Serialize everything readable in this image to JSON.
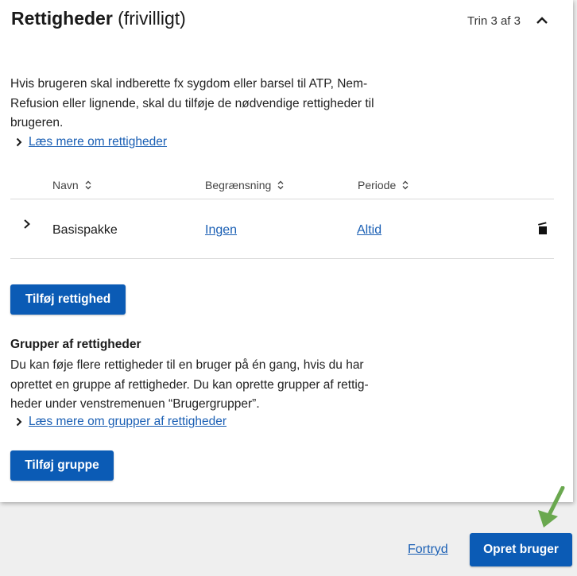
{
  "card": {
    "title_bold": "Rettigheder",
    "title_rest": " (frivilligt)",
    "step": "Trin 3 af 3",
    "collapse_icon": "chevron-up-icon"
  },
  "intro": {
    "text": "Hvis brugeren skal indberette fx sygdom eller barsel til ATP, Nem-Refusion eller lignende, skal du tilføje de nødvendige rettigheder til brugeren.",
    "link": "Læs mere om rettigheder"
  },
  "table": {
    "columns": [
      "Navn",
      "Begrænsning",
      "Periode"
    ],
    "rows": [
      {
        "name": "Basispakke",
        "restriction": "Ingen",
        "period": "Altid"
      }
    ]
  },
  "add_right_button": "Tilføj rettighed",
  "groups": {
    "title": "Grupper af rettigheder",
    "text": "Du kan føje flere rettigheder til en bruger på én gang, hvis du har oprettet en gruppe af rettigheder. Du kan oprette grupper af rettig-heder under venstremenuen “Brugergrupper”.",
    "link": "Læs mere om grupper af rettigheder",
    "add_group_button": "Tilføj gruppe"
  },
  "footer": {
    "cancel": "Fortryd",
    "create": "Opret bruger"
  },
  "colors": {
    "primary": "#0b5bb5",
    "link": "#1a5fb4",
    "annotation_arrow": "#6aa84f"
  }
}
